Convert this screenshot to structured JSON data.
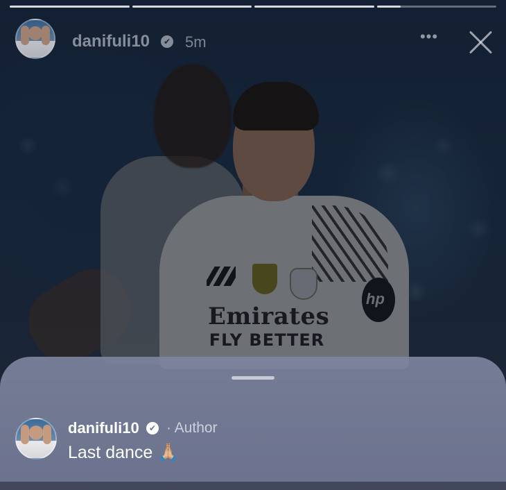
{
  "story": {
    "progress_segments": [
      {
        "fill_fraction": 1.0
      },
      {
        "fill_fraction": 1.0
      },
      {
        "fill_fraction": 1.0
      },
      {
        "fill_fraction": 0.2
      }
    ],
    "photo": {
      "sponsor_line1": "Emirates",
      "sponsor_line2": "FLY BETTER",
      "sleeve_logo": "hp"
    }
  },
  "header": {
    "username": "danifuli10",
    "verified_icon": "✔",
    "time": "5m",
    "more_icon": "•••",
    "close_icon": "close-icon"
  },
  "comment": {
    "username": "danifuli10",
    "verified_icon": "✔",
    "author_tag": "· Author",
    "text": "Last dance 🙏🏼"
  },
  "colors": {
    "sheet_background": "#767c98",
    "text": "#ffffff"
  }
}
